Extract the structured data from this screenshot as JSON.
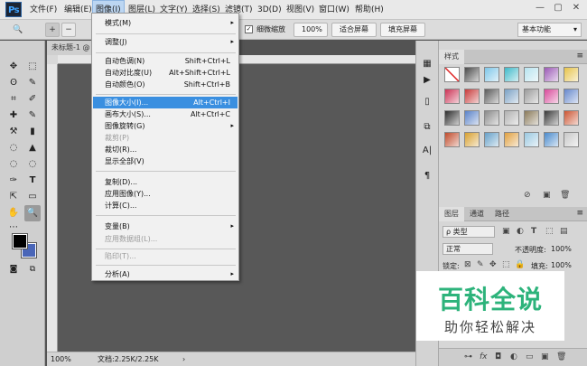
{
  "app": {
    "logo": "Ps"
  },
  "menubar": {
    "items": [
      "文件(F)",
      "编辑(E)",
      "图像(I)",
      "图层(L)",
      "文字(Y)",
      "选择(S)",
      "滤镜(T)",
      "3D(D)",
      "视图(V)",
      "窗口(W)",
      "帮助(H)"
    ],
    "active_index": 2
  },
  "window_controls": {
    "minimize": "—",
    "restore": "▢",
    "close": "✕"
  },
  "options": {
    "zoom_tool_icon": "🔍",
    "zoom_in_icon": "+",
    "zoom_out_icon": "−",
    "checkbox_label": "细微缩放",
    "zoom_value": "100%",
    "fit_screen": "适合屏幕",
    "fill_screen": "填充屏幕",
    "workspace": "基本功能",
    "workspace_arrow": "▾"
  },
  "document": {
    "tab_label": "未标题-1 @",
    "status_zoom": "100%",
    "status_doc": "文档:2.25K/2.25K",
    "status_arrow": "›"
  },
  "image_menu": {
    "items": [
      {
        "label": "模式(M)",
        "shortcut": "",
        "submenu": true,
        "disabled": false
      },
      {
        "label": "调整(J)",
        "shortcut": "",
        "submenu": true,
        "disabled": false
      },
      {
        "label": "自动色调(N)",
        "shortcut": "Shift+Ctrl+L",
        "submenu": false,
        "disabled": false
      },
      {
        "label": "自动对比度(U)",
        "shortcut": "Alt+Shift+Ctrl+L",
        "submenu": false,
        "disabled": false
      },
      {
        "label": "自动颜色(O)",
        "shortcut": "Shift+Ctrl+B",
        "submenu": false,
        "disabled": false
      },
      {
        "label": "图像大小(I)...",
        "shortcut": "Alt+Ctrl+I",
        "submenu": false,
        "disabled": false,
        "highlighted": true
      },
      {
        "label": "画布大小(S)...",
        "shortcut": "Alt+Ctrl+C",
        "submenu": false,
        "disabled": false
      },
      {
        "label": "图像旋转(G)",
        "shortcut": "",
        "submenu": true,
        "disabled": false
      },
      {
        "label": "裁剪(P)",
        "shortcut": "",
        "submenu": false,
        "disabled": true
      },
      {
        "label": "裁切(R)...",
        "shortcut": "",
        "submenu": false,
        "disabled": false
      },
      {
        "label": "显示全部(V)",
        "shortcut": "",
        "submenu": false,
        "disabled": false
      },
      {
        "label": "复制(D)...",
        "shortcut": "",
        "submenu": false,
        "disabled": false
      },
      {
        "label": "应用图像(Y)...",
        "shortcut": "",
        "submenu": false,
        "disabled": false
      },
      {
        "label": "计算(C)...",
        "shortcut": "",
        "submenu": false,
        "disabled": false
      },
      {
        "label": "变量(B)",
        "shortcut": "",
        "submenu": true,
        "disabled": false
      },
      {
        "label": "应用数据组(L)...",
        "shortcut": "",
        "submenu": false,
        "disabled": true
      },
      {
        "label": "陷印(T)...",
        "shortcut": "",
        "submenu": false,
        "disabled": true
      },
      {
        "label": "分析(A)",
        "shortcut": "",
        "submenu": true,
        "disabled": false
      }
    ],
    "submenu_arrow": "▸"
  },
  "toolbar": {
    "tools": [
      "✥",
      "⬚",
      "ʘ",
      "✎",
      "⌗",
      "✐",
      "✚",
      "✎",
      "⚒",
      "▮",
      "◌",
      "▲",
      "✑",
      "T",
      "⇱",
      "▭",
      "✋",
      "🔍",
      "⋯"
    ],
    "foreground_color": "#000000",
    "background_color": "#4a66b8"
  },
  "dock_icons": [
    "▦",
    "▶",
    "▯",
    "⧉",
    "A|",
    "¶"
  ],
  "styles_panel": {
    "tab": "样式",
    "menu_icon": "≡",
    "swatch_colors": [
      "#ffffff",
      "#4a4a4a",
      "#7ec6e8",
      "#3fb9c9",
      "#b7e3ef",
      "#9b59b6",
      "#e6c34a",
      "#cc3355",
      "#c83a3a",
      "#5a5a5a",
      "#7aa0c4",
      "#9a9a9a",
      "#d84a9a",
      "#6688cc",
      "#2b2b2b",
      "#5a82c8",
      "#8a8a8a",
      "#b0b0b0",
      "#8a7a5a",
      "#3a3a3a",
      "#cc5533",
      "#c04a2a",
      "#d8a030",
      "#66a0c8",
      "#e0a040",
      "#9ac8e0",
      "#4a8acc",
      "#c8c8c8"
    ],
    "footer_icons": [
      "⊘",
      "▣",
      "🗑"
    ]
  },
  "layers_panel": {
    "tabs": [
      "图层",
      "通道",
      "路径"
    ],
    "menu_icon": "≡",
    "kind_label": "ρ 类型",
    "filter_icons": [
      "▣",
      "◐",
      "T",
      "⬚",
      "▤"
    ],
    "blend_mode": "正常",
    "opacity_label": "不透明度:",
    "opacity_value": "100%",
    "lock_label": "锁定:",
    "lock_icons": [
      "⊠",
      "✎",
      "✥",
      "⬚",
      "🔒"
    ],
    "fill_label": "填充:",
    "fill_value": "100%",
    "footer_icons": [
      "⊶",
      "fx",
      "◘",
      "◐",
      "▭",
      "▣",
      "🗑"
    ]
  },
  "watermark": {
    "big": "百科全说",
    "small": "助你轻松解决",
    "color": "#2db37b"
  }
}
